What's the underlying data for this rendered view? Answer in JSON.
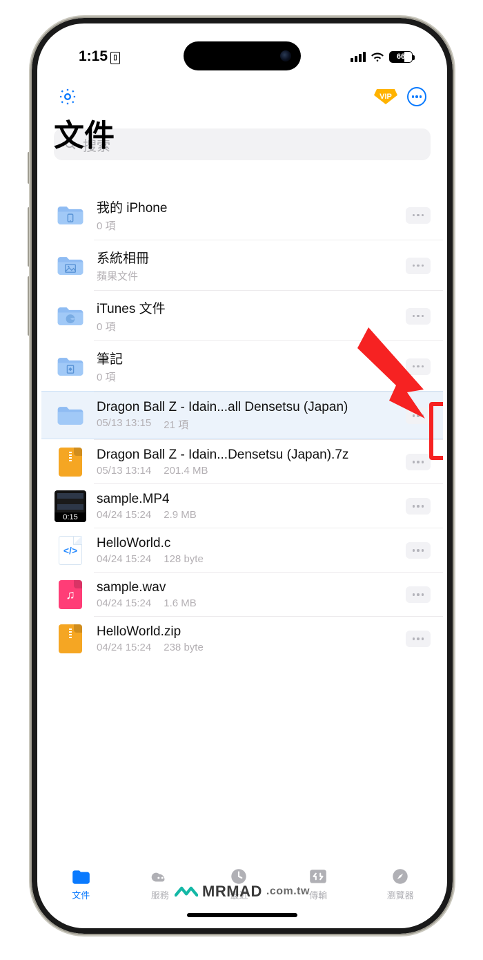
{
  "status": {
    "time": "1:15",
    "battery": "66"
  },
  "header": {
    "title": "文件",
    "search_placeholder": "搜索",
    "vip": "VIP"
  },
  "files": [
    {
      "name": "我的 iPhone",
      "meta1": "0 項",
      "meta2": "",
      "icon": "folder-iphone"
    },
    {
      "name": "系統相冊",
      "meta1": "蘋果文件",
      "meta2": "",
      "icon": "folder-photos"
    },
    {
      "name": "iTunes 文件",
      "meta1": "0 項",
      "meta2": "",
      "icon": "folder-itunes"
    },
    {
      "name": "筆記",
      "meta1": "0 項",
      "meta2": "",
      "icon": "folder-notes"
    },
    {
      "name": "Dragon Ball Z - Idain...all Densetsu (Japan)",
      "meta1": "05/13 13:15",
      "meta2": "21 項",
      "icon": "folder",
      "highlight": true
    },
    {
      "name": "Dragon Ball Z - Idain...Densetsu (Japan).7z",
      "meta1": "05/13 13:14",
      "meta2": "201.4 MB",
      "icon": "archive-orange"
    },
    {
      "name": "sample.MP4",
      "meta1": "04/24 15:24",
      "meta2": "2.9 MB",
      "icon": "video-thumb",
      "duration": "0:15"
    },
    {
      "name": "HelloWorld.c",
      "meta1": "04/24 15:24",
      "meta2": "128 byte",
      "icon": "code-file"
    },
    {
      "name": "sample.wav",
      "meta1": "04/24 15:24",
      "meta2": "1.6 MB",
      "icon": "archive-pink"
    },
    {
      "name": "HelloWorld.zip",
      "meta1": "04/24 15:24",
      "meta2": "238 byte",
      "icon": "archive-orange"
    }
  ],
  "tabs": [
    {
      "label": "文件",
      "icon": "file",
      "active": true
    },
    {
      "label": "服務",
      "icon": "cloud",
      "active": false
    },
    {
      "label": "最近",
      "icon": "clock",
      "active": false
    },
    {
      "label": "傳輸",
      "icon": "transfer",
      "active": false
    },
    {
      "label": "瀏覽器",
      "icon": "compass",
      "active": false
    }
  ],
  "watermark": {
    "brand": "MRMAD",
    "domain": ".com.tw"
  }
}
